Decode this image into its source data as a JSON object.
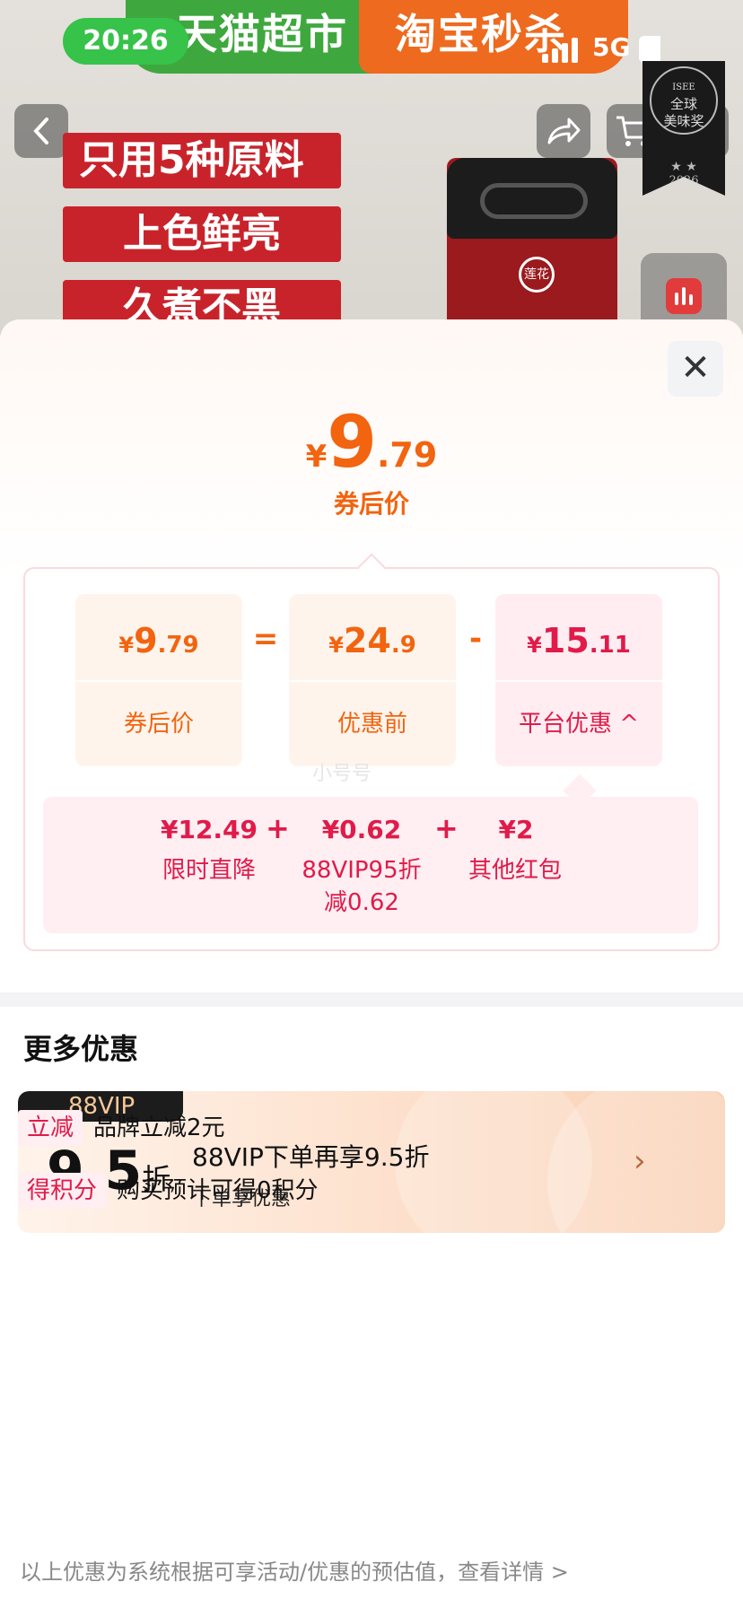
{
  "status_bar": {
    "time": "20:26",
    "network": "5G"
  },
  "banner": {
    "brand_left": "天猫超市",
    "brand_right": "淘宝秒杀"
  },
  "product_tags": [
    "只用5种原料",
    "上色鲜亮",
    "久煮不黑"
  ],
  "award": {
    "text_line1": "全球",
    "text_line2": "美味奖",
    "year": "2026",
    "org": "ISEE"
  },
  "bottle_label": "莲花",
  "price_header": {
    "currency": "¥",
    "integer": "9",
    "decimal": ".79",
    "label": "券后价"
  },
  "calc": {
    "after": {
      "currency": "¥",
      "integer": "9",
      "decimal": ".79",
      "label": "券后价"
    },
    "equals": "=",
    "before": {
      "currency": "¥",
      "integer": "24",
      "decimal": ".9",
      "label": "优惠前"
    },
    "minus": "-",
    "platform": {
      "currency": "¥",
      "integer": "15",
      "decimal": ".11",
      "label": "平台优惠"
    },
    "watermark": "小号号"
  },
  "breakdown": [
    {
      "value": "¥12.49",
      "label": "限时直降",
      "sub": ""
    },
    {
      "value": "¥0.62",
      "label": "88VIP95折",
      "sub": "减0.62"
    },
    {
      "value": "¥2",
      "label": "其他红包",
      "sub": ""
    }
  ],
  "plus": "+",
  "more": {
    "title": "更多优惠",
    "vip_card": {
      "badge": "88VIP",
      "discount_num": "9.5",
      "discount_unit": "折",
      "title": "88VIP下单再享9.5折",
      "subtitle": "下单享优惠"
    },
    "promos": [
      {
        "tag": "立减",
        "text": "品牌立减2元"
      },
      {
        "tag": "得积分",
        "text": "购买预计可得0积分"
      }
    ]
  },
  "footer": "以上优惠为系统根据可享活动/优惠的预估值，查看详情 >",
  "colors": {
    "accent_orange": "#f2640f",
    "accent_red": "#e01b4a",
    "status_green": "#37c24a"
  }
}
